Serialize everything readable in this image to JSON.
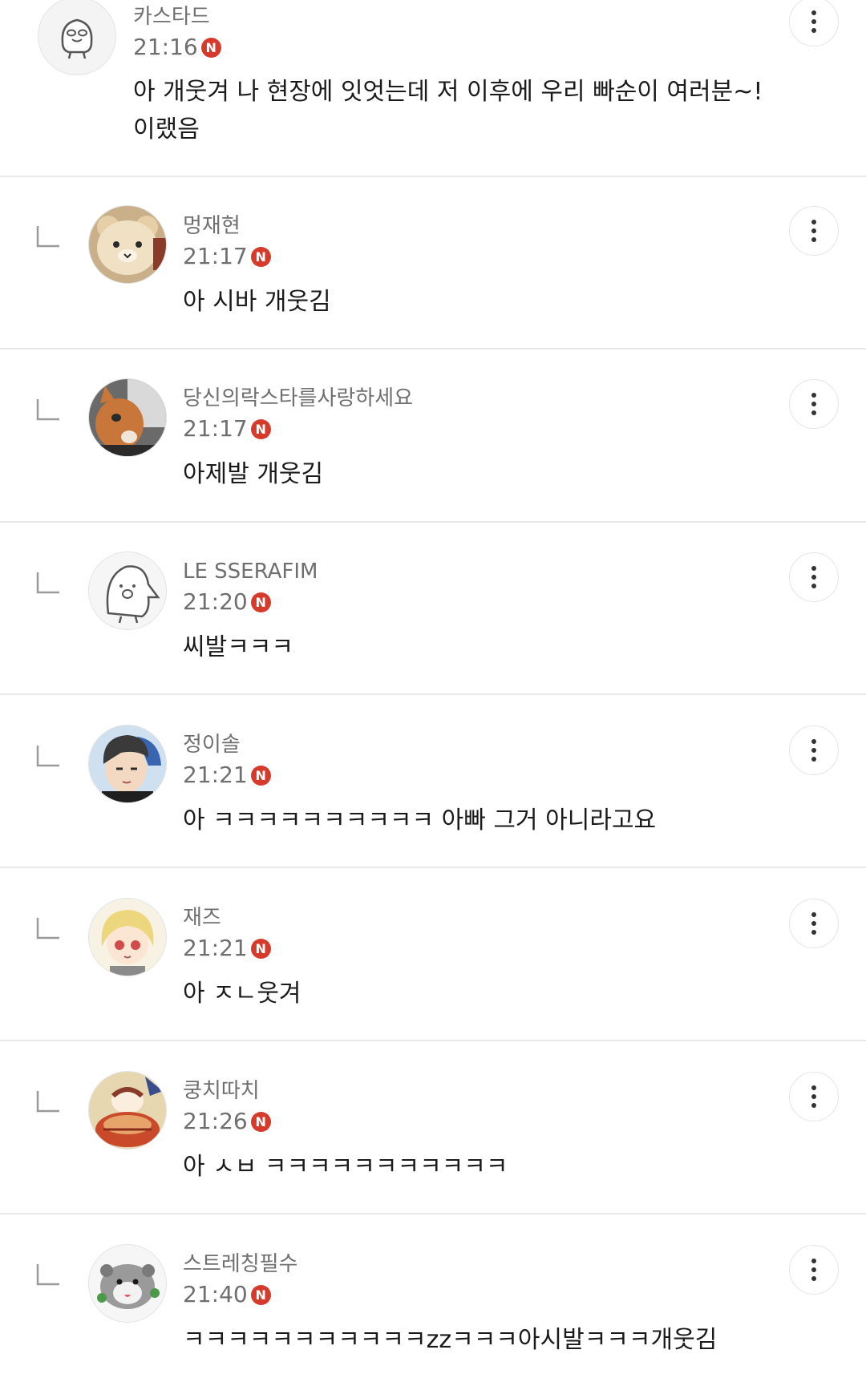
{
  "comments": [
    {
      "name": "카스타드",
      "time": "21:16",
      "badge": "N",
      "text": "아 개웃겨 나 현장에 잇엇는데 저 이후에 우리 빠순이 여러분~!",
      "text2": "이랬음"
    },
    {
      "name": "멍재현",
      "time": "21:17",
      "badge": "N",
      "text": "아 시바 개웃김"
    },
    {
      "name": "당신의락스타를사랑하세요",
      "time": "21:17",
      "badge": "N",
      "text": "아제발 개웃김"
    },
    {
      "name": "LE SSERAFIM",
      "time": "21:20",
      "badge": "N",
      "text": "씨발ㅋㅋㅋ"
    },
    {
      "name": "정이솔",
      "time": "21:21",
      "badge": "N",
      "text": "아 ㅋㅋㅋㅋㅋㅋㅋㅋㅋㅋ 아빠 그거 아니라고요"
    },
    {
      "name": "재즈",
      "time": "21:21",
      "badge": "N",
      "text": "아 ㅈㄴ웃겨"
    },
    {
      "name": "쿵치따치",
      "time": "21:26",
      "badge": "N",
      "text": "아 ㅅㅂ ㅋㅋㅋㅋㅋㅋㅋㅋㅋㅋㅋ"
    },
    {
      "name": "스트레칭필수",
      "time": "21:40",
      "badge": "N",
      "text": "ㅋㅋㅋㅋㅋㅋㅋㅋㅋㅋㅋzzㅋㅋㅋ아시발ㅋㅋㅋ개웃김"
    }
  ],
  "colors": {
    "badge": "#d63a2b",
    "meta": "#6f6f6f",
    "divider": "#e9e9e9"
  },
  "icons": {
    "reply": "reply-arrow-icon",
    "more": "more-vertical-icon"
  }
}
